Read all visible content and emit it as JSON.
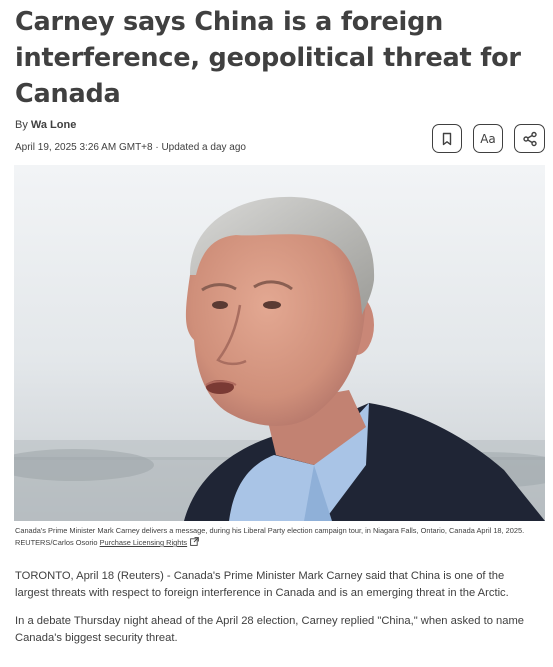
{
  "article": {
    "headline": "Carney says China is a foreign interference, geopolitical threat for Canada",
    "byline_prefix": "By ",
    "author": "Wa Lone",
    "dateline": "April 19, 2025 3:26 AM GMT+8 · Updated a day ago"
  },
  "toolbar": {
    "bookmark_icon": "bookmark-icon",
    "text_size_label": "Aa",
    "share_icon": "share-icon"
  },
  "photo": {
    "subject": "portrait of Prime Minister Mark Carney"
  },
  "caption": {
    "text": "Canada's Prime Minister Mark Carney delivers a message, during his Liberal Party election campaign tour, in Niagara Falls, Ontario, Canada April 18, 2025. REUTERS/Carlos Osorio ",
    "license_link": "Purchase Licensing Rights",
    "external_icon": "external-link-icon"
  },
  "body": {
    "paragraph_1": "TORONTO, April 18 (Reuters) - Canada's Prime Minister Mark Carney said that China is one of the largest threats with respect to foreign interference in Canada and is an emerging threat in the Arctic.",
    "paragraph_2": "In a debate Thursday night ahead of the April 28 election, Carney replied \"China,\" when asked to name Canada's biggest security threat."
  },
  "colors": {
    "text": "#404040",
    "background": "#ffffff"
  }
}
